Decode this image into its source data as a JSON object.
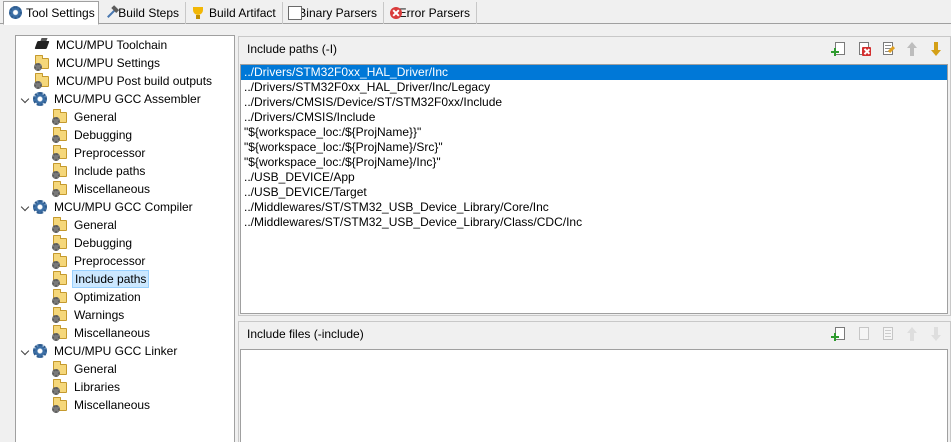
{
  "tabs": [
    {
      "label": "Tool Settings",
      "icon": "tool-settings-gear-icon",
      "active": true
    },
    {
      "label": "Build Steps",
      "icon": "build-steps-hammer-icon",
      "active": false
    },
    {
      "label": "Build Artifact",
      "icon": "build-artifact-trophy-icon",
      "active": false
    },
    {
      "label": "Binary Parsers",
      "icon": "binary-parsers-icon",
      "active": false
    },
    {
      "label": "Error Parsers",
      "icon": "error-parsers-icon",
      "active": false
    }
  ],
  "tree": {
    "items": [
      {
        "label": "MCU/MPU Toolchain",
        "icon": "chip-icon",
        "level": 0,
        "expandable": false
      },
      {
        "label": "MCU/MPU Settings",
        "icon": "folder-gear-icon",
        "level": 0,
        "expandable": false
      },
      {
        "label": "MCU/MPU Post build outputs",
        "icon": "folder-gear-icon",
        "level": 0,
        "expandable": false
      },
      {
        "label": "MCU/MPU GCC Assembler",
        "icon": "gear-icon",
        "level": 0,
        "expandable": true,
        "expanded": true
      },
      {
        "label": "General",
        "icon": "folder-gear-icon",
        "level": 1
      },
      {
        "label": "Debugging",
        "icon": "folder-gear-icon",
        "level": 1
      },
      {
        "label": "Preprocessor",
        "icon": "folder-gear-icon",
        "level": 1
      },
      {
        "label": "Include paths",
        "icon": "folder-gear-icon",
        "level": 1
      },
      {
        "label": "Miscellaneous",
        "icon": "folder-gear-icon",
        "level": 1
      },
      {
        "label": "MCU/MPU GCC Compiler",
        "icon": "gear-icon",
        "level": 0,
        "expandable": true,
        "expanded": true
      },
      {
        "label": "General",
        "icon": "folder-gear-icon",
        "level": 1
      },
      {
        "label": "Debugging",
        "icon": "folder-gear-icon",
        "level": 1
      },
      {
        "label": "Preprocessor",
        "icon": "folder-gear-icon",
        "level": 1
      },
      {
        "label": "Include paths",
        "icon": "folder-gear-icon",
        "level": 1,
        "selected": true
      },
      {
        "label": "Optimization",
        "icon": "folder-gear-icon",
        "level": 1
      },
      {
        "label": "Warnings",
        "icon": "folder-gear-icon",
        "level": 1
      },
      {
        "label": "Miscellaneous",
        "icon": "folder-gear-icon",
        "level": 1
      },
      {
        "label": "MCU/MPU GCC Linker",
        "icon": "gear-icon",
        "level": 0,
        "expandable": true,
        "expanded": true
      },
      {
        "label": "General",
        "icon": "folder-gear-icon",
        "level": 1
      },
      {
        "label": "Libraries",
        "icon": "folder-gear-icon",
        "level": 1
      },
      {
        "label": "Miscellaneous",
        "icon": "folder-gear-icon",
        "level": 1
      }
    ]
  },
  "include_paths": {
    "title": "Include paths (-I)",
    "toolbar": [
      "add-icon",
      "delete-icon",
      "edit-icon",
      "move-up-icon",
      "move-down-icon"
    ],
    "items": [
      "../Drivers/STM32F0xx_HAL_Driver/Inc",
      "../Drivers/STM32F0xx_HAL_Driver/Inc/Legacy",
      "../Drivers/CMSIS/Device/ST/STM32F0xx/Include",
      "../Drivers/CMSIS/Include",
      "\"${workspace_loc:/${ProjName}}\"",
      "\"${workspace_loc:/${ProjName}/Src}\"",
      "\"${workspace_loc:/${ProjName}/Inc}\"",
      "../USB_DEVICE/App",
      "../USB_DEVICE/Target",
      "../Middlewares/ST/STM32_USB_Device_Library/Core/Inc",
      "../Middlewares/ST/STM32_USB_Device_Library/Class/CDC/Inc"
    ],
    "selected_index": 0
  },
  "include_files": {
    "title": "Include files (-include)",
    "toolbar": [
      "add-icon",
      "delete-icon",
      "edit-icon",
      "move-up-icon",
      "move-down-icon"
    ],
    "items": []
  },
  "colors": {
    "selection": "#0078d7",
    "tree_selection": "#cce8ff",
    "background": "#f0f0f0"
  }
}
